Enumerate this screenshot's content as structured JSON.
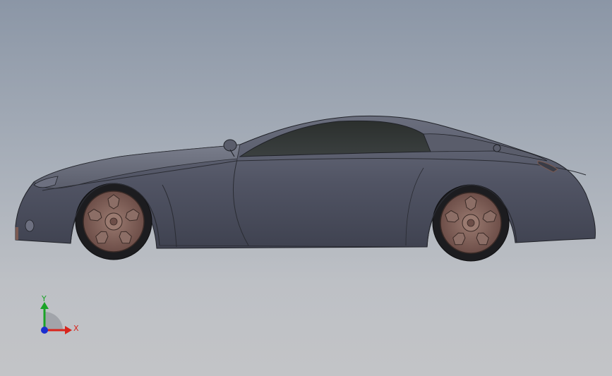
{
  "viewport": {
    "background_top": "#8b96a6",
    "background_bottom": "#c3c4c7"
  },
  "model": {
    "body_color": "#4e5160",
    "glass_color": "#2e332f",
    "rim_color": "#7a5a52",
    "tire_color": "#1c1c1f"
  },
  "triad": {
    "x_label": "X",
    "y_label": "Y",
    "x_color": "#d8241c",
    "y_color": "#1aa327",
    "z_color": "#1b2ed0",
    "icon": "coordinate-triad-icon"
  }
}
